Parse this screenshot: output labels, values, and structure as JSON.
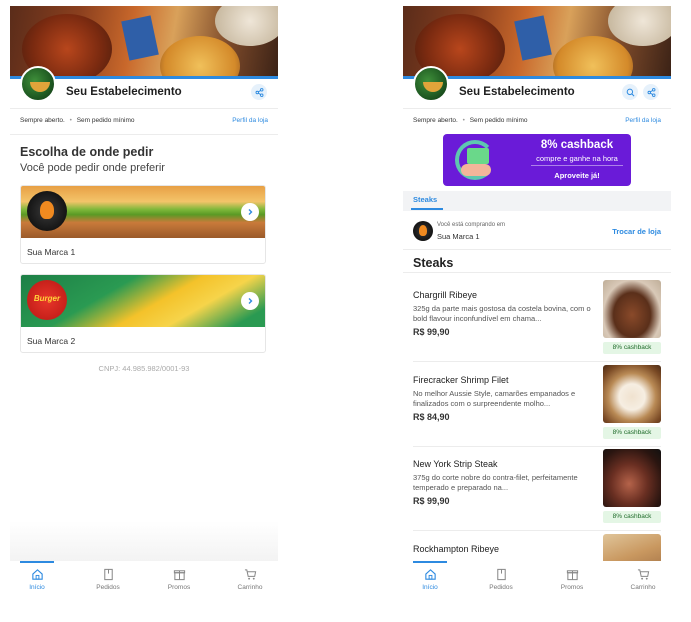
{
  "colors": {
    "accent": "#2d8ae0",
    "promo": "#6a1bd8",
    "cashback_bg": "#e4f6e5"
  },
  "store": {
    "name": "Seu Estabelecimento",
    "hours": "Sempre aberto.",
    "dot": "•",
    "min_order": "Sem pedido mínimo",
    "profile_link": "Perfil da loja"
  },
  "home": {
    "title": "Escolha de onde pedir",
    "subtitle": "Você pode pedir onde preferir",
    "brands": [
      {
        "name": "Sua Marca 1",
        "badge_icon": "flame-icon"
      },
      {
        "name": "Sua Marca 2",
        "badge_text": "Burger"
      }
    ],
    "cnpj": "CNPJ: 44.985.982/0001-93"
  },
  "promo": {
    "title": "8% cashback",
    "subtitle": "compre e ganhe na hora",
    "cta": "Aproveite já!"
  },
  "menu": {
    "tabs": [
      "Steaks"
    ],
    "buying_from_label": "Você está comprando em",
    "buying_from_name": "Sua Marca 1",
    "switch_store": "Trocar de loja",
    "section_title": "Steaks",
    "products": [
      {
        "name": "Chargrill Ribeye",
        "description": "325g da parte mais gostosa da costela bovina, com o bold flavour inconfundível em chama...",
        "price": "R$ 99,90",
        "cashback": "8% cashback"
      },
      {
        "name": "Firecracker Shrimp Filet",
        "description": "No melhor Aussie Style, camarões empanados e finalizados com o surpreendente molho...",
        "price": "R$ 84,90",
        "cashback": "8% cashback"
      },
      {
        "name": "New York Strip Steak",
        "description": "375g do corte nobre do contra-filet, perfeitamente temperado e preparado na...",
        "price": "R$ 99,90",
        "cashback": "8% cashback"
      },
      {
        "name": "Rockhampton Ribeye",
        "description": "",
        "price": "",
        "cashback": ""
      }
    ]
  },
  "nav": {
    "items": [
      {
        "label": "Início",
        "icon": "home-icon",
        "active": true
      },
      {
        "label": "Pedidos",
        "icon": "orders-icon",
        "active": false
      },
      {
        "label": "Promos",
        "icon": "gift-icon",
        "active": false
      },
      {
        "label": "Carrinho",
        "icon": "cart-icon",
        "active": false
      }
    ]
  }
}
